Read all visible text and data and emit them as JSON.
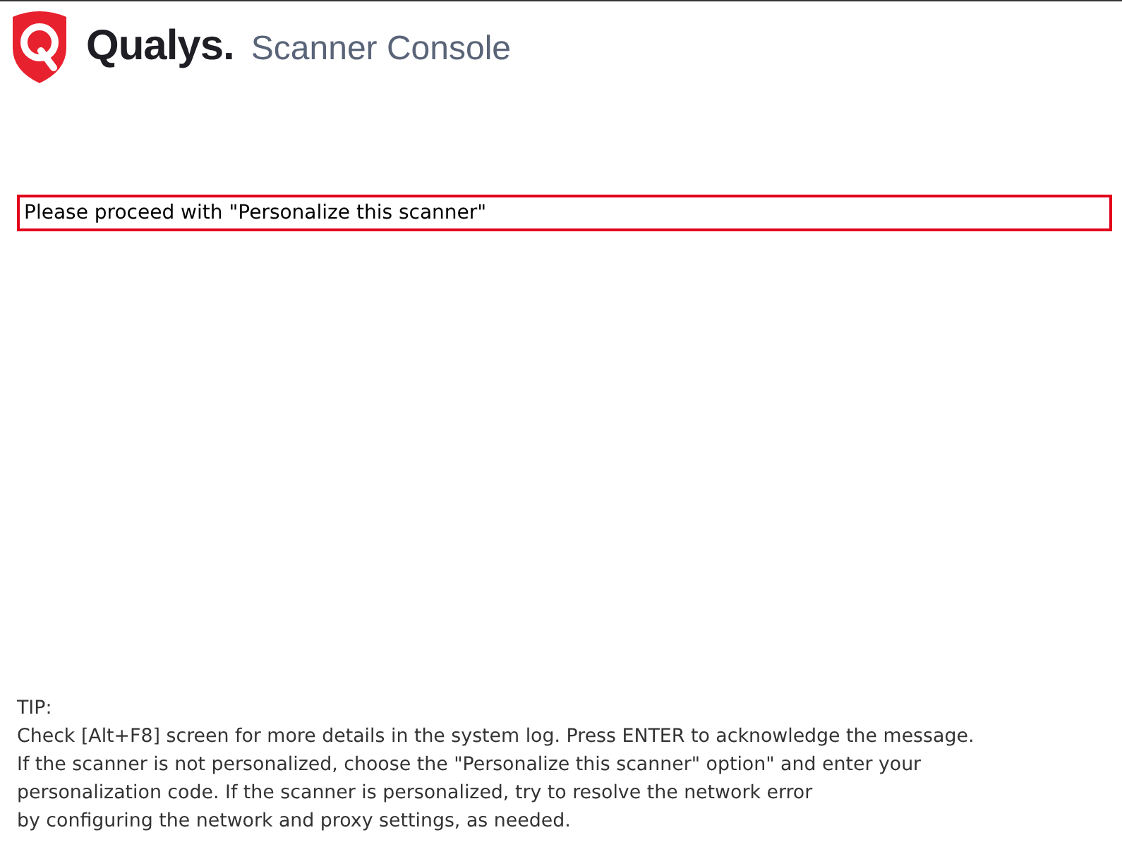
{
  "header": {
    "brand": "Qualys.",
    "product": "Scanner Console"
  },
  "message": "Please proceed with \"Personalize this scanner\"",
  "tip": {
    "heading": "TIP:",
    "lines": [
      "Check [Alt+F8] screen for more details in the system log. Press ENTER to acknowledge the message.",
      "If the scanner is not personalized, choose the \"Personalize this scanner\" option\" and enter your",
      "personalization code. If the scanner is personalized, try to resolve the network error",
      "by configuring the network and proxy settings, as needed."
    ]
  }
}
